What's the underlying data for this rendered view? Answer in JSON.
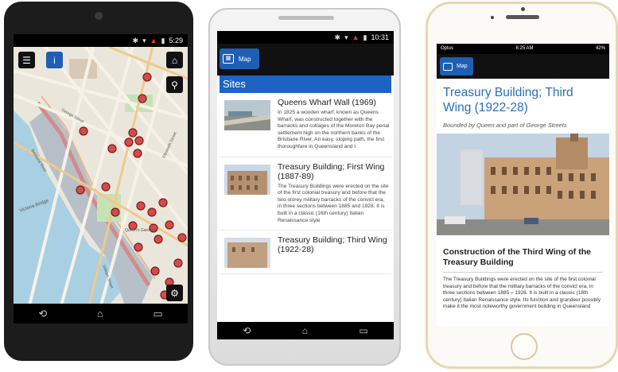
{
  "phone1": {
    "status_time": "5:29",
    "map": {
      "labels": {
        "victoria_bridge": "Victoria Bridge",
        "queens_gardens": "Queen's Gardens",
        "william_street": "William Street",
        "brisbane_river": "Brisbane River",
        "george_street": "George Street",
        "elizabeth_street": "Elizabeth Street"
      }
    }
  },
  "phone2": {
    "status_time": "10:31",
    "map_button_label": "Map",
    "section_title": "Sites",
    "sites": [
      {
        "title": "Queens Wharf Wall (1969)",
        "description": "In 1825 a wooden wharf, known as Queens Wharf, was constructed together with the barracks and cottages of the Moreton Bay penal settlement high on the northern banks of the Brisbane River. An easy, sloping path, the first thoroughfare in Queensland and t"
      },
      {
        "title": "Treasury Building; First Wing (1887-89)",
        "description": "The Treasury Buildings were erected on the site of the first colonial treasury and before that the two-storey military barracks of the convict era, in three sections between 1885 and 1928. It is built in a classic (16th century) Italian Renaissance style"
      },
      {
        "title": "Treasury Building; Third Wing (1922-28)",
        "description": ""
      }
    ]
  },
  "phone3": {
    "status_carrier": "Optus",
    "status_time": "6:25 AM",
    "status_battery": "42%",
    "map_button_label": "Map",
    "title": "Treasury Building; Third Wing (1922-28)",
    "subtitle": "Bounded by Queen and part of George Streets",
    "section_heading": "Construction of the Third Wing of the Treasury Building",
    "body": "The Treasury Buildings were erected on the site of the first colonial treasury and before that the military barracks of the convict era, in three sections between 1885 – 1928. It is built in a classic (16th century) Italian Renaissance style. Its function and grandeur possibly make it the most noteworthy government building in Queensland"
  }
}
